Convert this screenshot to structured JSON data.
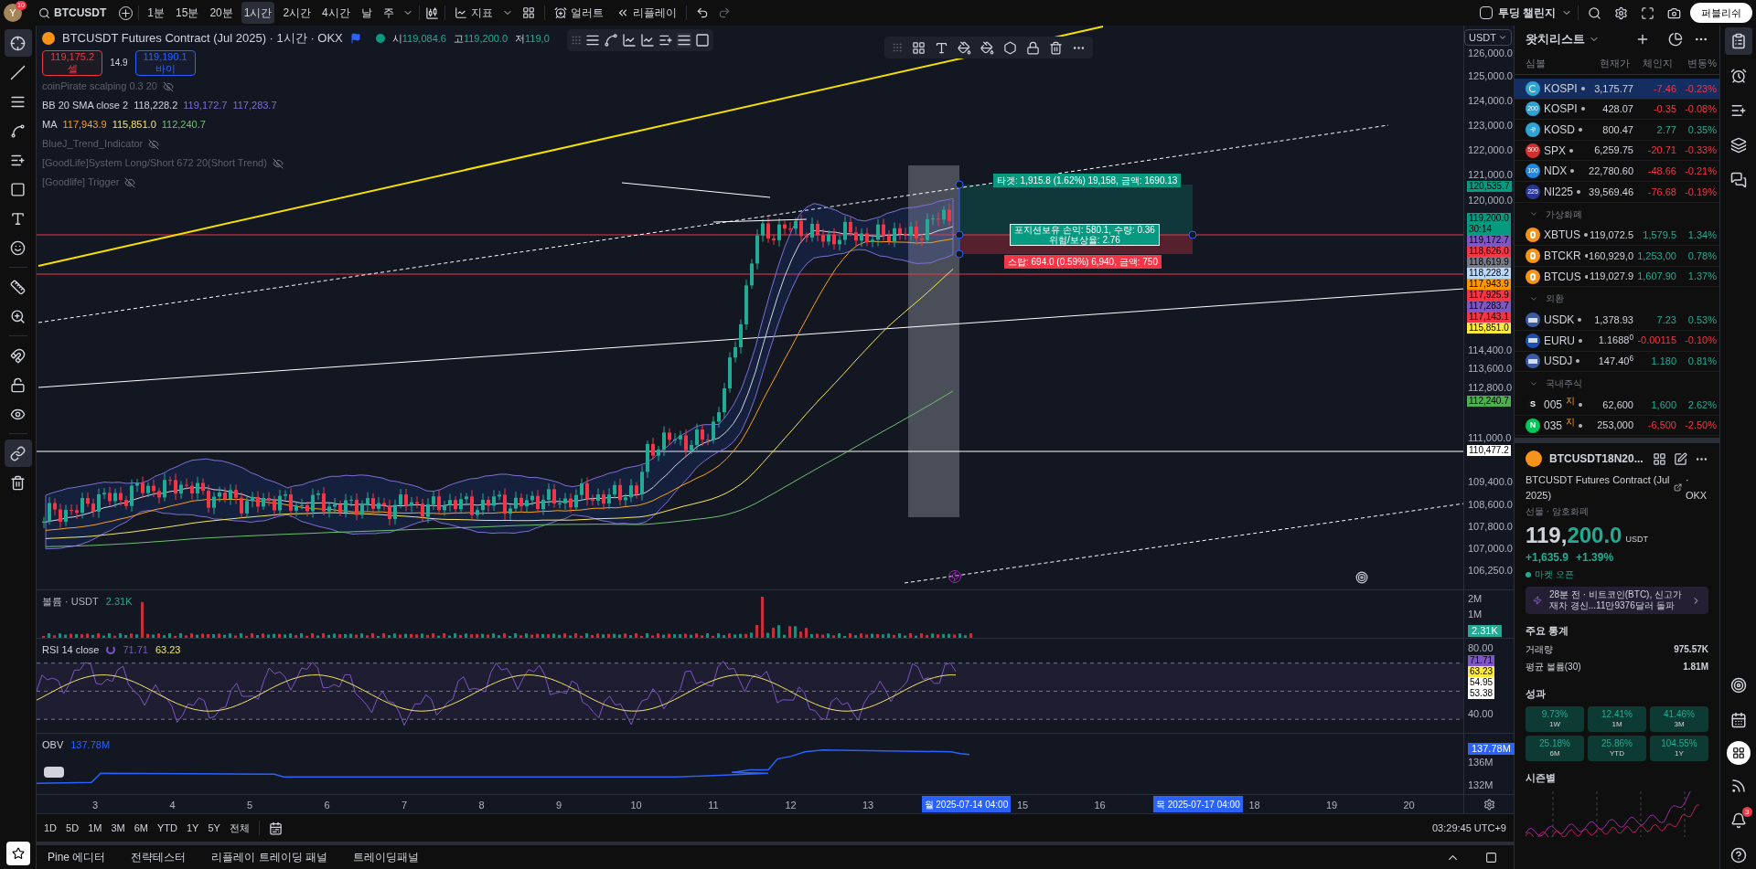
{
  "toolbar": {
    "avatar": "Y",
    "notification_count": "10",
    "symbol": "BTCUSDT",
    "intervals": [
      {
        "label": "1분",
        "selected": false
      },
      {
        "label": "15분",
        "selected": false
      },
      {
        "label": "20분",
        "selected": false
      },
      {
        "label": "1시간",
        "selected": true
      },
      {
        "label": "2시간",
        "selected": false
      },
      {
        "label": "4시간",
        "selected": false
      },
      {
        "label": "날",
        "selected": false
      },
      {
        "label": "주",
        "selected": false
      }
    ],
    "indicators_label": "지표",
    "alert_label": "얼러트",
    "replay_label": "리플레이",
    "challenge_label": "투딩 챌린지",
    "challenge_checked": false,
    "publish_label": "퍼블리쉬"
  },
  "chart": {
    "title": "BTCUSDT Futures Contract (Jul 2025) · 1시간 · OKX",
    "ohlc": [
      {
        "label": "시",
        "value": "119,084.6"
      },
      {
        "label": "고",
        "value": "119,200.0"
      },
      {
        "label": "저",
        "value": "119,0"
      }
    ],
    "sell": {
      "price": "119,175.2",
      "label": "셀"
    },
    "spread": "14.9",
    "buy": {
      "price": "119,190.1",
      "label": "바이"
    },
    "indicators": [
      {
        "name": "coinPirate scalping 0.3 20",
        "hidden": true
      },
      {
        "name": "BB 20 SMA close 2",
        "hidden": false,
        "values": [
          {
            "text": "118,228.2",
            "color": "#d1d4dc"
          },
          {
            "text": "119,172.7",
            "color": "#7e6fd6"
          },
          {
            "text": "117,283.7",
            "color": "#7e6fd6"
          }
        ]
      },
      {
        "name": "MA",
        "hidden": false,
        "values": [
          {
            "text": "117,943.9",
            "color": "#f7a21b"
          },
          {
            "text": "115,851.0",
            "color": "#f5e663"
          },
          {
            "text": "112,240.7",
            "color": "#6fbf73"
          }
        ]
      },
      {
        "name": "BlueJ_Trend_Indicator",
        "hidden": true
      },
      {
        "name": "[GoodLife]System Long/Short 672 20(Short Trend)",
        "hidden": true
      },
      {
        "name": "[Goodlife] Trigger",
        "hidden": true
      }
    ],
    "target_label": "타겟: 1,915.8 (1.62%) 19,158, 금액: 1690.13",
    "position_label": "포지션보유 손익: 580.1, 수량: 0.36",
    "risk_label": "위험/보상율: 2.76",
    "stop_label": "스탑: 694.0 (0.59%) 6,940, 금액: 750",
    "currency": "USDT",
    "price_axis": [
      "126,000.0",
      "125,000.0",
      "124,000.0",
      "123,000.0",
      "122,000.0",
      "121,000.0",
      "120,000.0",
      "114,400.0",
      "113,600.0",
      "112,800.0",
      "111,000.0",
      "109,400.0",
      "108,600.0",
      "107,800.0",
      "107,000.0",
      "106,250.0"
    ],
    "price_tags": [
      {
        "text": "120,535.7",
        "color": "#089981"
      },
      {
        "text": "119,200.0",
        "sub": "30:14",
        "color": "#089981"
      },
      {
        "text": "119,172.7",
        "color": "#7e57c2"
      },
      {
        "text": "118,626.0",
        "color": "#f23645"
      },
      {
        "text": "118,619.9",
        "color": "#787b86"
      },
      {
        "text": "118,228.2",
        "color": "#bbd9fb"
      },
      {
        "text": "117,943.9",
        "color": "#ff9800"
      },
      {
        "text": "117,925.9",
        "color": "#f23645"
      },
      {
        "text": "117,283.7",
        "color": "#7e57c2"
      },
      {
        "text": "117,143.1",
        "color": "#f23645"
      },
      {
        "text": "115,851.0",
        "color": "#ffeb3b"
      }
    ],
    "green_tag": {
      "text": "112,240.7",
      "color": "#4caf50"
    },
    "white_tag": {
      "text": "110,477.2",
      "color": "#ffffff"
    }
  },
  "volume": {
    "title": "볼륨 · USDT",
    "value": "2.31K",
    "axis": [
      "2M",
      "1M"
    ],
    "tag": "2.31K"
  },
  "rsi": {
    "title": "RSI 14 close",
    "values": [
      {
        "text": "71.71",
        "color": "#7e57c2"
      },
      {
        "text": "63.23",
        "color": "#f5e663"
      }
    ],
    "axis": [
      "80.00",
      "40.00"
    ],
    "tags": [
      {
        "text": "71.71",
        "color": "#7e57c2"
      },
      {
        "text": "63.23",
        "color": "#ffeb3b"
      },
      {
        "text": "54.95",
        "color": "#ffffff"
      },
      {
        "text": "53.38",
        "color": "#ffffff"
      }
    ]
  },
  "obv": {
    "title": "OBV",
    "value": "137.78M",
    "axis": [
      "136M",
      "132M"
    ],
    "tag": "137.78M"
  },
  "time_axis": [
    {
      "kind": "tick",
      "label": "3"
    },
    {
      "kind": "tick",
      "label": "4"
    },
    {
      "kind": "tick",
      "label": "5"
    },
    {
      "kind": "tick",
      "label": "6"
    },
    {
      "kind": "tick",
      "label": "7"
    },
    {
      "kind": "tick",
      "label": "8"
    },
    {
      "kind": "tick",
      "label": "9"
    },
    {
      "kind": "tick",
      "label": "10"
    },
    {
      "kind": "tick",
      "label": "11"
    },
    {
      "kind": "tick",
      "label": "12"
    },
    {
      "kind": "tick",
      "label": "13"
    },
    {
      "kind": "cursor",
      "label": "월 2025-07-14   04:00"
    },
    {
      "kind": "tick",
      "label": "15"
    },
    {
      "kind": "tick",
      "label": "16"
    },
    {
      "kind": "cursor",
      "label": "목 2025-07-17   04:00"
    },
    {
      "kind": "tick",
      "label": "18"
    },
    {
      "kind": "tick",
      "label": "19"
    },
    {
      "kind": "tick",
      "label": "20"
    }
  ],
  "ranges": [
    "1D",
    "5D",
    "1M",
    "3M",
    "6M",
    "YTD",
    "1Y",
    "5Y",
    "전체"
  ],
  "clock": "03:29:45 UTC+9",
  "bottom_tabs": [
    "Pine 에디터",
    "전략테스터",
    "리플레이 트레이딩 패널",
    "트레이딩패널"
  ],
  "watchlist": {
    "title": "왓치리스트",
    "columns": [
      "심볼",
      "현재가",
      "체인지",
      "변동%"
    ],
    "sections": [
      {
        "rows": [
          {
            "icon": {
              "kind": "swirl",
              "color": "#2ea3d5"
            },
            "symbol": "KOSPI",
            "price": "3,175.77",
            "change": "-7.46",
            "change_pct": "-0.23%",
            "up": false,
            "selected": true
          },
          {
            "icon": {
              "kind": "badge",
              "text": "200",
              "color": "#2ea3d5"
            },
            "symbol": "KOSPI",
            "price": "428.07",
            "change": "-0.35",
            "change_pct": "-0.08%",
            "up": false,
            "selected": false
          },
          {
            "icon": {
              "kind": "arrows",
              "color": "#2ea3d5"
            },
            "symbol": "KOSD",
            "price": "800.47",
            "change": "2.77",
            "change_pct": "0.35%",
            "up": true,
            "selected": false
          },
          {
            "icon": {
              "kind": "badge",
              "text": "500",
              "color": "#d32f2f"
            },
            "symbol": "SPX",
            "price": "6,259.75",
            "change": "-20.71",
            "change_pct": "-0.33%",
            "up": false,
            "selected": false
          },
          {
            "icon": {
              "kind": "badge",
              "text": "100",
              "color": "#1e88e5"
            },
            "symbol": "NDX",
            "price": "22,780.60",
            "change": "-48.66",
            "change_pct": "-0.21%",
            "up": false,
            "selected": false
          },
          {
            "icon": {
              "kind": "badge",
              "text": "225",
              "color": "#283593"
            },
            "symbol": "NI225",
            "price": "39,569.46",
            "change": "-76.68",
            "change_pct": "-0.19%",
            "up": false,
            "selected": false
          }
        ]
      },
      {
        "name": "가상화폐",
        "expanded": true,
        "rows": [
          {
            "icon": {
              "kind": "coin",
              "color": "#f7931a"
            },
            "symbol": "XBTUS",
            "price": "119,072.5",
            "change": "1,579.5",
            "change_pct": "1.34%",
            "up": true,
            "selected": false
          },
          {
            "icon": {
              "kind": "coin",
              "color": "#f7931a"
            },
            "symbol": "BTCKR",
            "price": "160,929,0",
            "change": "1,253,00",
            "change_pct": "0.78%",
            "up": true,
            "selected": false
          },
          {
            "icon": {
              "kind": "coin",
              "color": "#f7931a"
            },
            "symbol": "BTCUS",
            "price": "119,027.9",
            "change": "1,607.90",
            "change_pct": "1.37%",
            "up": true,
            "selected": false
          }
        ]
      },
      {
        "name": "외환",
        "expanded": true,
        "rows": [
          {
            "icon": {
              "kind": "flag",
              "color": "#3c5aa6"
            },
            "symbol": "USDK",
            "price": "1,378.93",
            "change": "7.23",
            "change_pct": "0.53%",
            "up": true,
            "selected": false
          },
          {
            "icon": {
              "kind": "flag",
              "color": "#1e4fb0"
            },
            "symbol": "EURU",
            "price": "1.1688$^{0}$",
            "change": "-0.00115",
            "change_pct": "-0.10%",
            "up": false,
            "selected": false
          },
          {
            "icon": {
              "kind": "flag",
              "color": "#3c5aa6"
            },
            "symbol": "USDJ",
            "price": "147.40$^{6}$",
            "change": "1.180",
            "change_pct": "0.81%",
            "up": true,
            "selected": false
          }
        ]
      },
      {
        "name": "국내주식",
        "expanded": true,
        "rows": [
          {
            "icon": {
              "kind": "letter",
              "text": "S",
              "color": "#111111"
            },
            "symbol": "005",
            "tag": "지",
            "price": "62,600",
            "change": "1,600",
            "change_pct": "2.62%",
            "up": true,
            "selected": false
          },
          {
            "icon": {
              "kind": "letter",
              "text": "N",
              "color": "#03c75a"
            },
            "symbol": "035",
            "tag": "지",
            "price": "253,000",
            "change": "-6,500",
            "change_pct": "-2.50%",
            "up": false,
            "selected": false
          }
        ]
      }
    ]
  },
  "detail": {
    "symbol": "BTCUSDT18N20...",
    "name": "BTCUSDT Futures Contract (Jul 2025)",
    "exchange": "· OKX",
    "category": "선물 · 암호화폐",
    "price_head": "119,",
    "price_tail": "200.0",
    "currency": "USDT",
    "change": "+1,635.9",
    "change_pct": "+1.39%",
    "market_status": "마켓 오픈",
    "news": "28분 전 · 비트코인(BTC), 신고가 재차 경신...11만9376달러 돌파",
    "stats_title": "주요 통계",
    "stats": [
      {
        "label": "거래량",
        "value": "975.57K"
      },
      {
        "label": "평균 볼륨(30)",
        "value": "1.81M"
      }
    ],
    "performance_title": "성과",
    "performance": [
      {
        "value": "9.73%",
        "period": "1W"
      },
      {
        "value": "12.41%",
        "period": "1M"
      },
      {
        "value": "41.46%",
        "period": "3M"
      },
      {
        "value": "25.18%",
        "period": "6M"
      },
      {
        "value": "25.86%",
        "period": "YTD"
      },
      {
        "value": "104.55%",
        "period": "1Y"
      }
    ],
    "seasonal_title": "시즌별"
  },
  "side_badge": "3"
}
